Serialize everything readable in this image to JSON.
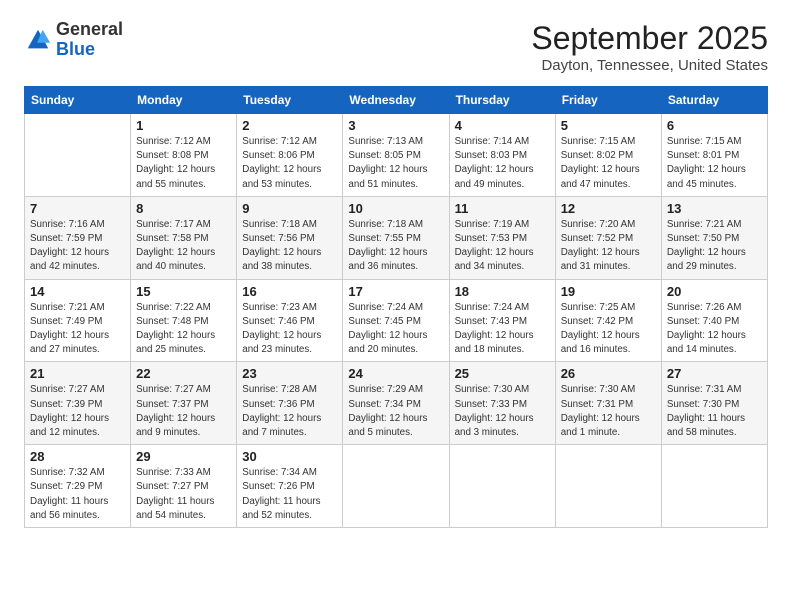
{
  "header": {
    "logo": {
      "general": "General",
      "blue": "Blue"
    },
    "month": "September 2025",
    "location": "Dayton, Tennessee, United States"
  },
  "weekdays": [
    "Sunday",
    "Monday",
    "Tuesday",
    "Wednesday",
    "Thursday",
    "Friday",
    "Saturday"
  ],
  "weeks": [
    [
      {
        "day": "",
        "info": ""
      },
      {
        "day": "1",
        "info": "Sunrise: 7:12 AM\nSunset: 8:08 PM\nDaylight: 12 hours\nand 55 minutes."
      },
      {
        "day": "2",
        "info": "Sunrise: 7:12 AM\nSunset: 8:06 PM\nDaylight: 12 hours\nand 53 minutes."
      },
      {
        "day": "3",
        "info": "Sunrise: 7:13 AM\nSunset: 8:05 PM\nDaylight: 12 hours\nand 51 minutes."
      },
      {
        "day": "4",
        "info": "Sunrise: 7:14 AM\nSunset: 8:03 PM\nDaylight: 12 hours\nand 49 minutes."
      },
      {
        "day": "5",
        "info": "Sunrise: 7:15 AM\nSunset: 8:02 PM\nDaylight: 12 hours\nand 47 minutes."
      },
      {
        "day": "6",
        "info": "Sunrise: 7:15 AM\nSunset: 8:01 PM\nDaylight: 12 hours\nand 45 minutes."
      }
    ],
    [
      {
        "day": "7",
        "info": "Sunrise: 7:16 AM\nSunset: 7:59 PM\nDaylight: 12 hours\nand 42 minutes."
      },
      {
        "day": "8",
        "info": "Sunrise: 7:17 AM\nSunset: 7:58 PM\nDaylight: 12 hours\nand 40 minutes."
      },
      {
        "day": "9",
        "info": "Sunrise: 7:18 AM\nSunset: 7:56 PM\nDaylight: 12 hours\nand 38 minutes."
      },
      {
        "day": "10",
        "info": "Sunrise: 7:18 AM\nSunset: 7:55 PM\nDaylight: 12 hours\nand 36 minutes."
      },
      {
        "day": "11",
        "info": "Sunrise: 7:19 AM\nSunset: 7:53 PM\nDaylight: 12 hours\nand 34 minutes."
      },
      {
        "day": "12",
        "info": "Sunrise: 7:20 AM\nSunset: 7:52 PM\nDaylight: 12 hours\nand 31 minutes."
      },
      {
        "day": "13",
        "info": "Sunrise: 7:21 AM\nSunset: 7:50 PM\nDaylight: 12 hours\nand 29 minutes."
      }
    ],
    [
      {
        "day": "14",
        "info": "Sunrise: 7:21 AM\nSunset: 7:49 PM\nDaylight: 12 hours\nand 27 minutes."
      },
      {
        "day": "15",
        "info": "Sunrise: 7:22 AM\nSunset: 7:48 PM\nDaylight: 12 hours\nand 25 minutes."
      },
      {
        "day": "16",
        "info": "Sunrise: 7:23 AM\nSunset: 7:46 PM\nDaylight: 12 hours\nand 23 minutes."
      },
      {
        "day": "17",
        "info": "Sunrise: 7:24 AM\nSunset: 7:45 PM\nDaylight: 12 hours\nand 20 minutes."
      },
      {
        "day": "18",
        "info": "Sunrise: 7:24 AM\nSunset: 7:43 PM\nDaylight: 12 hours\nand 18 minutes."
      },
      {
        "day": "19",
        "info": "Sunrise: 7:25 AM\nSunset: 7:42 PM\nDaylight: 12 hours\nand 16 minutes."
      },
      {
        "day": "20",
        "info": "Sunrise: 7:26 AM\nSunset: 7:40 PM\nDaylight: 12 hours\nand 14 minutes."
      }
    ],
    [
      {
        "day": "21",
        "info": "Sunrise: 7:27 AM\nSunset: 7:39 PM\nDaylight: 12 hours\nand 12 minutes."
      },
      {
        "day": "22",
        "info": "Sunrise: 7:27 AM\nSunset: 7:37 PM\nDaylight: 12 hours\nand 9 minutes."
      },
      {
        "day": "23",
        "info": "Sunrise: 7:28 AM\nSunset: 7:36 PM\nDaylight: 12 hours\nand 7 minutes."
      },
      {
        "day": "24",
        "info": "Sunrise: 7:29 AM\nSunset: 7:34 PM\nDaylight: 12 hours\nand 5 minutes."
      },
      {
        "day": "25",
        "info": "Sunrise: 7:30 AM\nSunset: 7:33 PM\nDaylight: 12 hours\nand 3 minutes."
      },
      {
        "day": "26",
        "info": "Sunrise: 7:30 AM\nSunset: 7:31 PM\nDaylight: 12 hours\nand 1 minute."
      },
      {
        "day": "27",
        "info": "Sunrise: 7:31 AM\nSunset: 7:30 PM\nDaylight: 11 hours\nand 58 minutes."
      }
    ],
    [
      {
        "day": "28",
        "info": "Sunrise: 7:32 AM\nSunset: 7:29 PM\nDaylight: 11 hours\nand 56 minutes."
      },
      {
        "day": "29",
        "info": "Sunrise: 7:33 AM\nSunset: 7:27 PM\nDaylight: 11 hours\nand 54 minutes."
      },
      {
        "day": "30",
        "info": "Sunrise: 7:34 AM\nSunset: 7:26 PM\nDaylight: 11 hours\nand 52 minutes."
      },
      {
        "day": "",
        "info": ""
      },
      {
        "day": "",
        "info": ""
      },
      {
        "day": "",
        "info": ""
      },
      {
        "day": "",
        "info": ""
      }
    ]
  ]
}
